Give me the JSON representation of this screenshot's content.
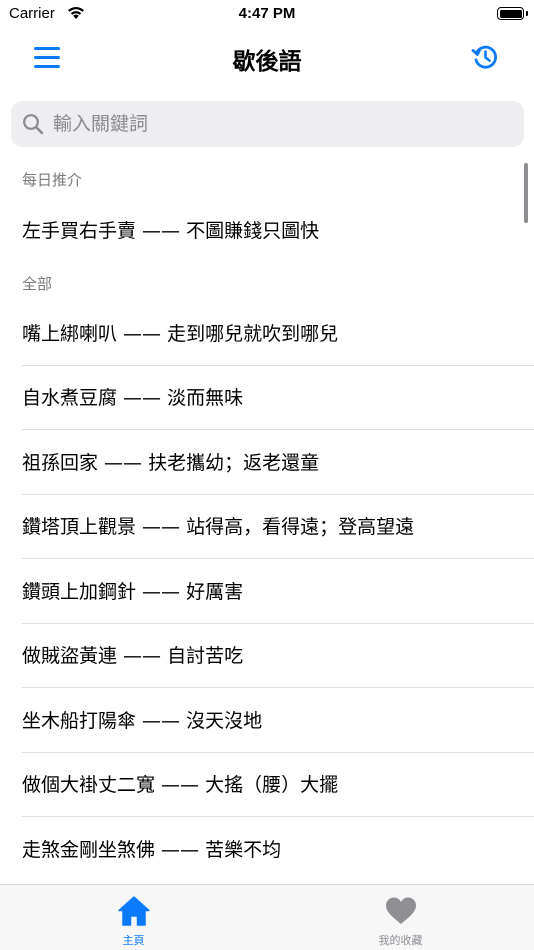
{
  "status_bar": {
    "carrier": "Carrier",
    "time": "4:47 PM"
  },
  "nav": {
    "title": "歇後語",
    "menu_icon": "hamburger-menu-icon",
    "history_icon": "history-clock-icon"
  },
  "search": {
    "placeholder": "輸入關鍵詞",
    "value": ""
  },
  "daily": {
    "header": "每日推介",
    "item": "左手買右手賣 —— 不圖賺錢只圖快"
  },
  "all": {
    "header": "全部",
    "items": [
      "嘴上綁喇叭 —— 走到哪兒就吹到哪兒",
      "自水煮豆腐 —— 淡而無味",
      "祖孫回家 —— 扶老攜幼；返老還童",
      "鑽塔頂上觀景 —— 站得高，看得遠；登高望遠",
      "鑽頭上加鋼針 —— 好厲害",
      "做賊盜黃連 —— 自討苦吃",
      "坐木船打陽傘 —— 沒天沒地",
      "做個大褂丈二寬 —— 大搖（腰）大擺",
      "走煞金剛坐煞佛 —— 苦樂不均"
    ]
  },
  "tabs": [
    {
      "label": "主頁",
      "icon": "home-icon",
      "active": true
    },
    {
      "label": "我的收藏",
      "icon": "heart-icon",
      "active": false
    }
  ],
  "colors": {
    "accent": "#0a7aff",
    "inactive": "#8e8e93",
    "section_header": "#7a7a7e"
  }
}
